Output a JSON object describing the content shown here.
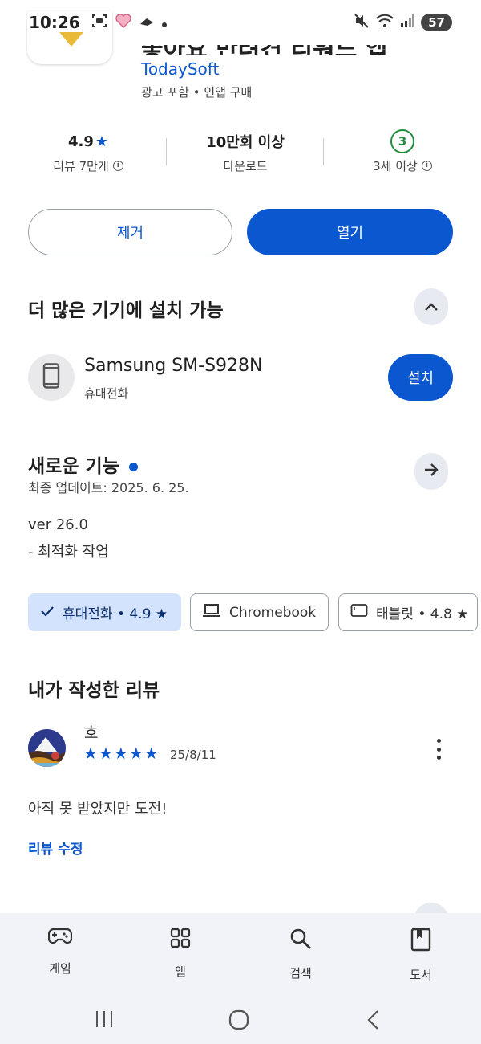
{
  "status_bar": {
    "time": "10:26",
    "battery": "57"
  },
  "app": {
    "title": "좋아요 반려견 리워드 앱",
    "developer": "TodaySoft",
    "tags": "광고 포함 • 인앱 구매"
  },
  "stats": {
    "rating": {
      "value": "4.9",
      "label": "리뷰 7만개"
    },
    "downloads": {
      "value": "10만회 이상",
      "label": "다운로드"
    },
    "age": {
      "badge": "3",
      "label": "3세 이상"
    }
  },
  "actions": {
    "remove_label": "제거",
    "open_label": "열기"
  },
  "more_devices": {
    "title": "더 많은 기기에 설치 가능",
    "device_name": "Samsung SM-S928N",
    "device_type": "휴대전화",
    "install_label": "설치"
  },
  "whats_new": {
    "title": "새로운 기능",
    "updated": "최종 업데이트: 2025. 6. 25.",
    "notes": [
      "ver 26.0",
      "- 최적화 작업"
    ]
  },
  "device_chips": [
    {
      "label": "휴대전화 • 4.9 ★",
      "selected": true
    },
    {
      "label": "Chromebook",
      "selected": false
    },
    {
      "label": "태블릿 • 4.8 ★",
      "selected": false
    }
  ],
  "my_review": {
    "title": "내가 작성한 리뷰",
    "reviewer": "호",
    "stars": 5,
    "date": "25/8/11",
    "text": "아직 못 받았지만 도전!",
    "edit_label": "리뷰 수정"
  },
  "bottom_nav": {
    "items": [
      {
        "label": "게임",
        "icon": "gamepad-icon"
      },
      {
        "label": "앱",
        "icon": "apps-grid-icon"
      },
      {
        "label": "검색",
        "icon": "search-icon"
      },
      {
        "label": "도서",
        "icon": "book-icon"
      }
    ]
  },
  "colors": {
    "accent": "#0b57d0",
    "chip_selected": "#d3e3fd",
    "age_badge": "#1e8e3e",
    "nav_background": "#f1f3f8"
  }
}
